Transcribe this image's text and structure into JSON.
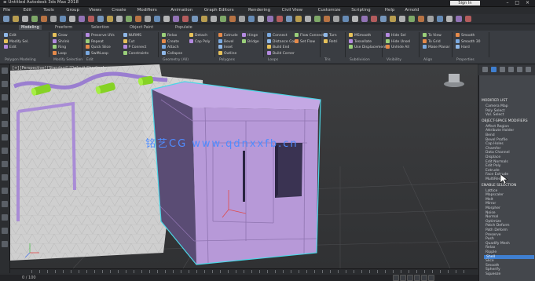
{
  "window": {
    "title": "≡ Untitled   Autodesk 3ds Max 2018",
    "sign_in": "Sign In",
    "controls": "– □ ×"
  },
  "menu": [
    "File",
    "Edit",
    "Tools",
    "Group",
    "Views",
    "Create",
    "Modifiers",
    "Animation",
    "Graph Editors",
    "Rendering",
    "Civil View",
    "Customize",
    "Scripting",
    "Help",
    "Arnold"
  ],
  "ribbon": {
    "tabs": [
      "Modeling",
      "Freeform",
      "Selection",
      "Object Paint",
      "Populate"
    ],
    "active_tab": "Modeling",
    "groups": [
      {
        "label": "Polygon Modeling",
        "buttons": [
          "Edit",
          "Modify Sel.",
          "Edit"
        ]
      },
      {
        "label": "Modify Selection",
        "buttons": [
          "Grow",
          "Shrink",
          "Ring",
          "Loop"
        ]
      },
      {
        "label": "Edit",
        "buttons": [
          "Preserve UVs",
          "Repeat",
          "Quick Slice",
          "SwiftLoop",
          "NURMS",
          "Cut",
          "P Connect",
          "Constraints"
        ]
      },
      {
        "label": "Geometry (All)",
        "buttons": [
          "Relax",
          "Create",
          "Attach",
          "Collapse",
          "Detach",
          "Cap Poly"
        ]
      },
      {
        "label": "Polygons",
        "buttons": [
          "Extrude",
          "Bevel",
          "Inset",
          "Outline",
          "Hinge",
          "Bridge"
        ]
      },
      {
        "label": "Loops",
        "buttons": [
          "Connect",
          "Distance Con.",
          "Build End",
          "Build Corner",
          "Flow Connect",
          "Set Flow"
        ]
      },
      {
        "label": "Tris",
        "buttons": [
          "Turn",
          "Retri"
        ]
      },
      {
        "label": "Subdivision",
        "buttons": [
          "MSmooth",
          "Tessellate",
          "Use Displacement"
        ]
      },
      {
        "label": "Visibility",
        "buttons": [
          "Hide Sel",
          "Hide Unsel",
          "Unhide All"
        ]
      },
      {
        "label": "Align",
        "buttons": [
          "To View",
          "To Grid",
          "Make Planar"
        ]
      },
      {
        "label": "Properties",
        "buttons": [
          "Smooth",
          "Smooth 30",
          "Hard"
        ]
      }
    ]
  },
  "viewport": {
    "label": "[+] [Perspective] [Standard] [Default Shading]",
    "watermark": "铭艺CG  www.qdnxxfb.cn"
  },
  "command_panel": {
    "sections": [
      {
        "head": "MODIFIER LIST",
        "items": [
          "Camera Map",
          "Poly Select",
          "Vol. Select"
        ]
      },
      {
        "head": "OBJECT-SPACE MODIFIERS",
        "items": [
          "Affect Region",
          "Attribute Holder",
          "Bend",
          "Bevel Profile",
          "Cap Holes",
          "Chamfer",
          "Data Channel",
          "Displace",
          "Edit Normals",
          "Edit Poly",
          "Extrude",
          "Face Extrude",
          "MultiRes"
        ]
      },
      {
        "head": "ENABLE SELECTION",
        "selected": "Shell",
        "items": [
          "Lattice",
          "Mapscaler",
          "Melt",
          "Mirror",
          "Morpher",
          "Noise",
          "Normal",
          "Optimize",
          "Patch Deform",
          "Path Deform",
          "Preserve",
          "Push",
          "Quadify Mesh",
          "Relax",
          "Ripple",
          "Shell",
          "Slice",
          "Smooth",
          "Spherify",
          "Squeeze"
        ]
      }
    ]
  },
  "timeline": {
    "frame_counter": "0 / 100"
  },
  "colors": {
    "box_face": "#b799d8",
    "box_dark": "#574a6e",
    "selection_highlight": "#4cd6e6",
    "accent_blue": "#3f7fd0"
  }
}
